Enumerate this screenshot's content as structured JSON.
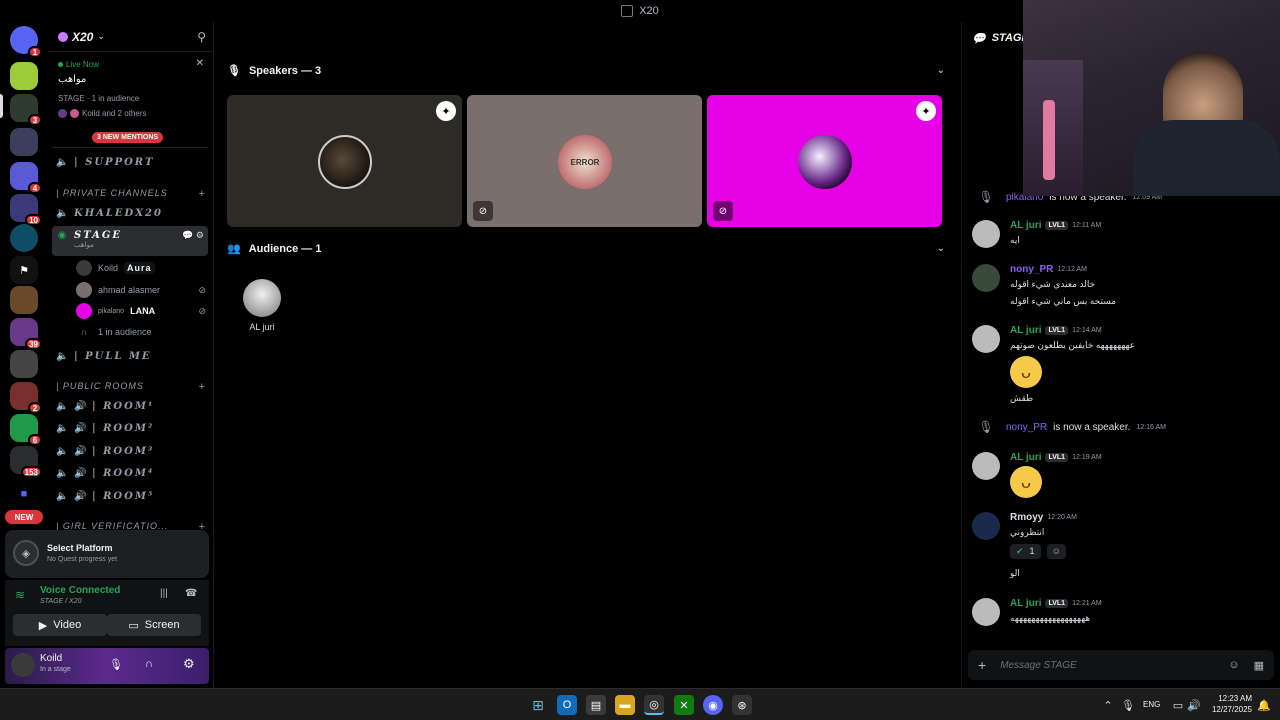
{
  "window": {
    "title": "X20"
  },
  "server": {
    "name": "X20",
    "notification_badge": "1"
  },
  "rail": {
    "badges": [
      "1",
      "3",
      "4",
      "10",
      "39",
      "2",
      "6",
      "153"
    ],
    "new_label": "NEW"
  },
  "live_card": {
    "status": "Live Now",
    "title": "مواهب",
    "meta": "STAGE · 1 in audience",
    "participants": "Koild and 2 others",
    "mentions": "3 NEW MENTIONS"
  },
  "channels": {
    "support": "| SUPPORT",
    "private_category": "| PRIVATE CHANNELS",
    "khaledx20": "KHALEDX20",
    "stage": "STAGE",
    "stage_topic": "مواهب",
    "members": [
      {
        "name": "Koild",
        "tag": "Aura"
      },
      {
        "name": "ahmad alasmer",
        "tag": ""
      },
      {
        "name": "pikalano",
        "tag": "LANA"
      }
    ],
    "audience": "1 in audience",
    "pullme": "| PULL ME",
    "public_category": "| PUBLIC ROOMS",
    "rooms": [
      "| ROOM¹",
      "| ROOM²",
      "| ROOM³",
      "| ROOM⁴",
      "| ROOM⁵"
    ],
    "girl_category": "| GIRL VERIFICATIO..."
  },
  "quest": {
    "title": "Select Platform",
    "subtitle": "No Quest progress yet"
  },
  "voice": {
    "status": "Voice Connected",
    "location": "STAGE / X20",
    "video": "Video",
    "screen": "Screen"
  },
  "user": {
    "name": "Koild",
    "status": "In a stage"
  },
  "stage": {
    "speakers_header": "Speakers — 3",
    "audience_header": "Audience — 1",
    "audience_members": [
      {
        "name": "AL juri"
      }
    ],
    "tile_colors": [
      "#2d2b25",
      "#7a6f6d",
      "#e600e6"
    ]
  },
  "chat": {
    "header": "STAGE",
    "messages": [
      {
        "name": "AL juri",
        "level": "LVL1",
        "time": "12:11 AM",
        "text": "ايه"
      },
      {
        "name": "nony_PR",
        "time": "12:12 AM",
        "text": "خالد معندي شيء اقوله",
        "text2": "مستحه بس ماني شيء اقوله"
      },
      {
        "name": "AL juri",
        "level": "LVL1",
        "time": "12:14 AM",
        "text": "عهههههههه خايفين يطلعون صوتهم",
        "text2": "طقش"
      },
      {
        "name": "AL juri",
        "level": "LVL1",
        "time": "12:19 AM"
      },
      {
        "name": "Rmoyy",
        "time": "12:20 AM",
        "text": "انتظروني",
        "reaction_count": "1",
        "text2": "الو"
      },
      {
        "name": "AL juri",
        "level": "LVL1",
        "time": "12:21 AM",
        "text": "ههههههههههههههههههه"
      }
    ],
    "system": [
      {
        "name": "pikalano",
        "text": "is now a speaker.",
        "time": "12:09 AM"
      },
      {
        "name": "nony_PR",
        "text": "is now a speaker.",
        "time": "12:16 AM"
      }
    ],
    "input_placeholder": "Message STAGE"
  },
  "taskbar": {
    "lang": "ENG",
    "time": "12:23 AM",
    "date": "12/27/2025"
  }
}
